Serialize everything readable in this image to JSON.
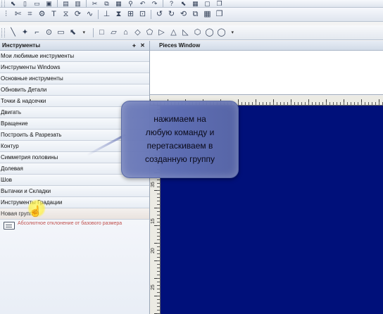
{
  "toolbar_row1": {
    "icons": [
      "cursor-arrow-icon",
      "new-file-icon",
      "open-folder-icon",
      "save-icon",
      "print-icon",
      "print-preview-icon",
      "cut-icon",
      "copy-icon",
      "paste-icon",
      "zoom-icon",
      "undo-icon",
      "redo-icon",
      "help-icon",
      "pointer-help-icon",
      "grid-icon",
      "window-icon",
      "restore-icon"
    ]
  },
  "toolbar_row2": {
    "icons": [
      "split-icon",
      "scissors-icon",
      "pattern-icon",
      "wand-icon",
      "text-tool-icon",
      "mirror-icon",
      "rotate-icon",
      "curve-icon",
      "notch-icon",
      "pleat-icon",
      "grade-icon",
      "measure-icon",
      "undo-arrow-icon",
      "redo-arrow-icon",
      "refresh-icon",
      "pieces-icon"
    ]
  },
  "toolbar_row3": {
    "shape_glyphs": [
      "□",
      "▱",
      "⌂",
      "◇",
      "⬠",
      "▷",
      "△",
      "◺",
      "⬡",
      "◯",
      "◯"
    ]
  },
  "left_panel": {
    "title": "Инструменты",
    "pin_glyph": "ᚐ",
    "close_glyph": "✕",
    "categories": [
      "Мои любимые инструменты",
      "Инструменты Windows",
      "Основные инструменты",
      "Обновить Детали",
      "Точки & надсечки",
      "Двигать",
      "Вращение",
      "Построить & Разрезать",
      "Контур",
      "Симметрия половины",
      "Долевая",
      "Шов",
      "Вытачки и Складки",
      "Инструменты Градации",
      "Новая группа"
    ],
    "group_tool_label": "Абсолютное отклонение от базового размера"
  },
  "pieces_window": {
    "title": "Pieces Window"
  },
  "ruler_left": {
    "labels": [
      "35",
      "15",
      "20",
      "25"
    ]
  },
  "callout": {
    "text": "нажимаем на\nлюбую команду и\nперетаскиваем в\nсозданную группу"
  },
  "colors": {
    "work_area": "#00107a",
    "callout": "#6a7bbd",
    "group_tool_label": "#c0504d"
  }
}
